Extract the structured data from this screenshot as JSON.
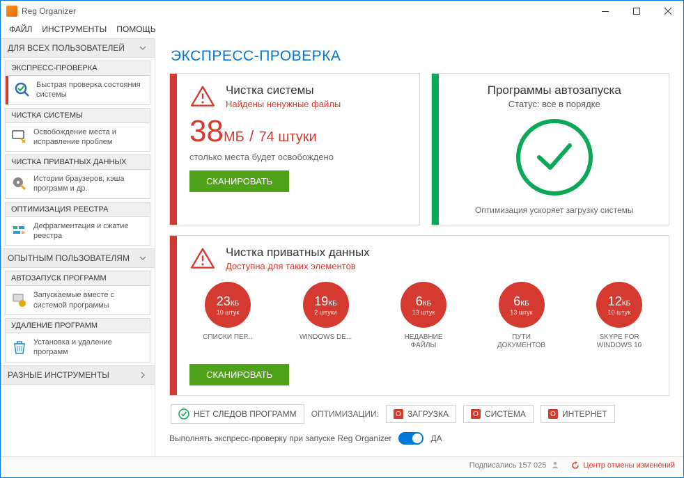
{
  "app": {
    "title": "Reg Organizer"
  },
  "menu": {
    "file": "ФАЙЛ",
    "tools": "ИНСТРУМЕНТЫ",
    "help": "ПОМОЩЬ"
  },
  "sidebar": {
    "section_all": "ДЛЯ ВСЕХ ПОЛЬЗОВАТЕЛЕЙ",
    "section_expert": "ОПЫТНЫМ ПОЛЬЗОВАТЕЛЯМ",
    "section_misc": "РАЗНЫЕ ИНСТРУМЕНТЫ",
    "groups": {
      "express": {
        "title": "ЭКСПРЕСС-ПРОВЕРКА",
        "desc": "Быстрая проверка состояния системы"
      },
      "clean": {
        "title": "ЧИСТКА СИСТЕМЫ",
        "desc": "Освобождение места и исправление проблем"
      },
      "private": {
        "title": "ЧИСТКА ПРИВАТНЫХ ДАННЫХ",
        "desc": "Истории браузеров, кэша программ и др."
      },
      "regopt": {
        "title": "ОПТИМИЗАЦИЯ РЕЕСТРА",
        "desc": "Дефрагментация и сжатие реестра"
      },
      "autostart": {
        "title": "АВТОЗАПУСК ПРОГРАММ",
        "desc": "Запускаемые вместе с системой программы"
      },
      "uninstall": {
        "title": "УДАЛЕНИЕ ПРОГРАММ",
        "desc": "Установка и удаление программ"
      }
    }
  },
  "page": {
    "title": "ЭКСПРЕСС-ПРОВЕРКА",
    "cleanup": {
      "title": "Чистка системы",
      "sub": "Найдены ненужные файлы",
      "num": "38",
      "unit": "МБ",
      "sep": "/",
      "count": "74 штуки",
      "meta": "столько места будет освобождено",
      "scan": "СКАНИРОВАТЬ"
    },
    "autostart": {
      "title": "Программы автозапуска",
      "status": "Статус: все в порядке",
      "note": "Оптимизация ускоряет загрузку системы"
    },
    "private": {
      "title": "Чистка приватных данных",
      "sub": "Доступна для таких элементов",
      "scan": "СКАНИРОВАТЬ",
      "items": [
        {
          "val": "23",
          "unit": "КБ",
          "count": "10 штук",
          "label": "СПИСКИ ПЕР..."
        },
        {
          "val": "19",
          "unit": "КБ",
          "count": "2 штуки",
          "label": "WINDOWS DE..."
        },
        {
          "val": "6",
          "unit": "КБ",
          "count": "13 штук",
          "label": "НЕДАВНИЕ ФАЙЛЫ"
        },
        {
          "val": "6",
          "unit": "КБ",
          "count": "13 штук",
          "label": "ПУТИ ДОКУМЕНТОВ"
        },
        {
          "val": "12",
          "unit": "КБ",
          "count": "10 штук",
          "label": "SKYPE FOR WINDOWS 10"
        }
      ]
    },
    "bottom": {
      "no_traces": "НЕТ СЛЕДОВ ПРОГРАММ",
      "opt_label": "ОПТИМИЗАЦИИ:",
      "boot": "ЗАГРУЗКА",
      "system": "СИСТЕМА",
      "internet": "ИНТЕРНЕТ"
    },
    "toggle": {
      "label": "Выполнять экспресс-проверку при запуске Reg Organizer",
      "state": "ДА"
    }
  },
  "status": {
    "subscribers": "Подписались 157 025",
    "undo": "Центр отмены изменений"
  }
}
